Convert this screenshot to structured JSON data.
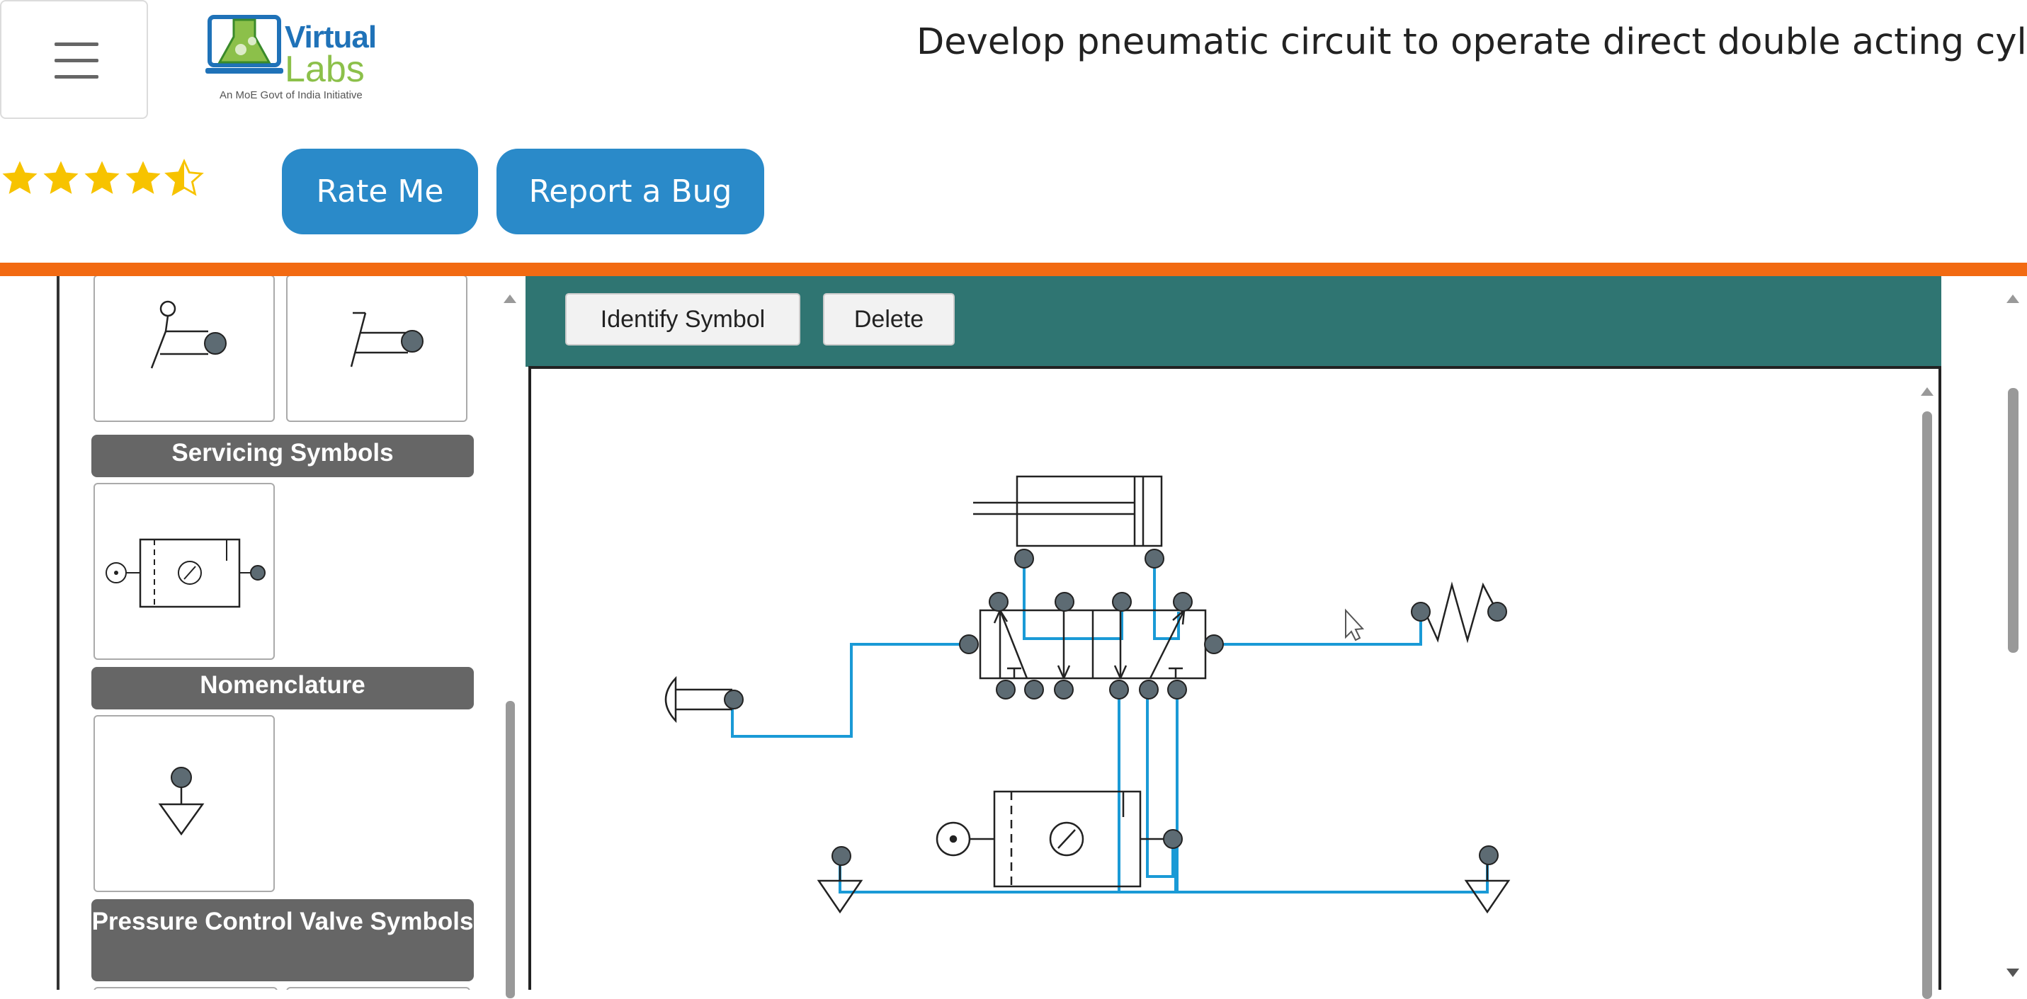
{
  "header": {
    "title": "Develop pneumatic circuit to operate direct double acting cylinder",
    "logo": {
      "virtual": "Virtual",
      "labs": "Labs",
      "tagline": "An MoE Govt of India Initiative"
    },
    "menu_icon": "hamburger-icon"
  },
  "rating": {
    "value": 4.5,
    "max": 5,
    "color": "#f7c300"
  },
  "buttons": {
    "rate_me": "Rate Me",
    "report_bug": "Report a Bug"
  },
  "palette": {
    "categories": [
      {
        "label": "Servicing Symbols"
      },
      {
        "label": "Nomenclature"
      },
      {
        "label": "Pressure Control Valve Symbols"
      }
    ]
  },
  "toolbar": {
    "identify": "Identify Symbol",
    "delete": "Delete"
  },
  "colors": {
    "accent_orange": "#f26a12",
    "teal": "#2f7572",
    "button_blue": "#2a8ac9",
    "wire_blue": "#1a9ad6",
    "port_gray": "#5d6b73"
  }
}
